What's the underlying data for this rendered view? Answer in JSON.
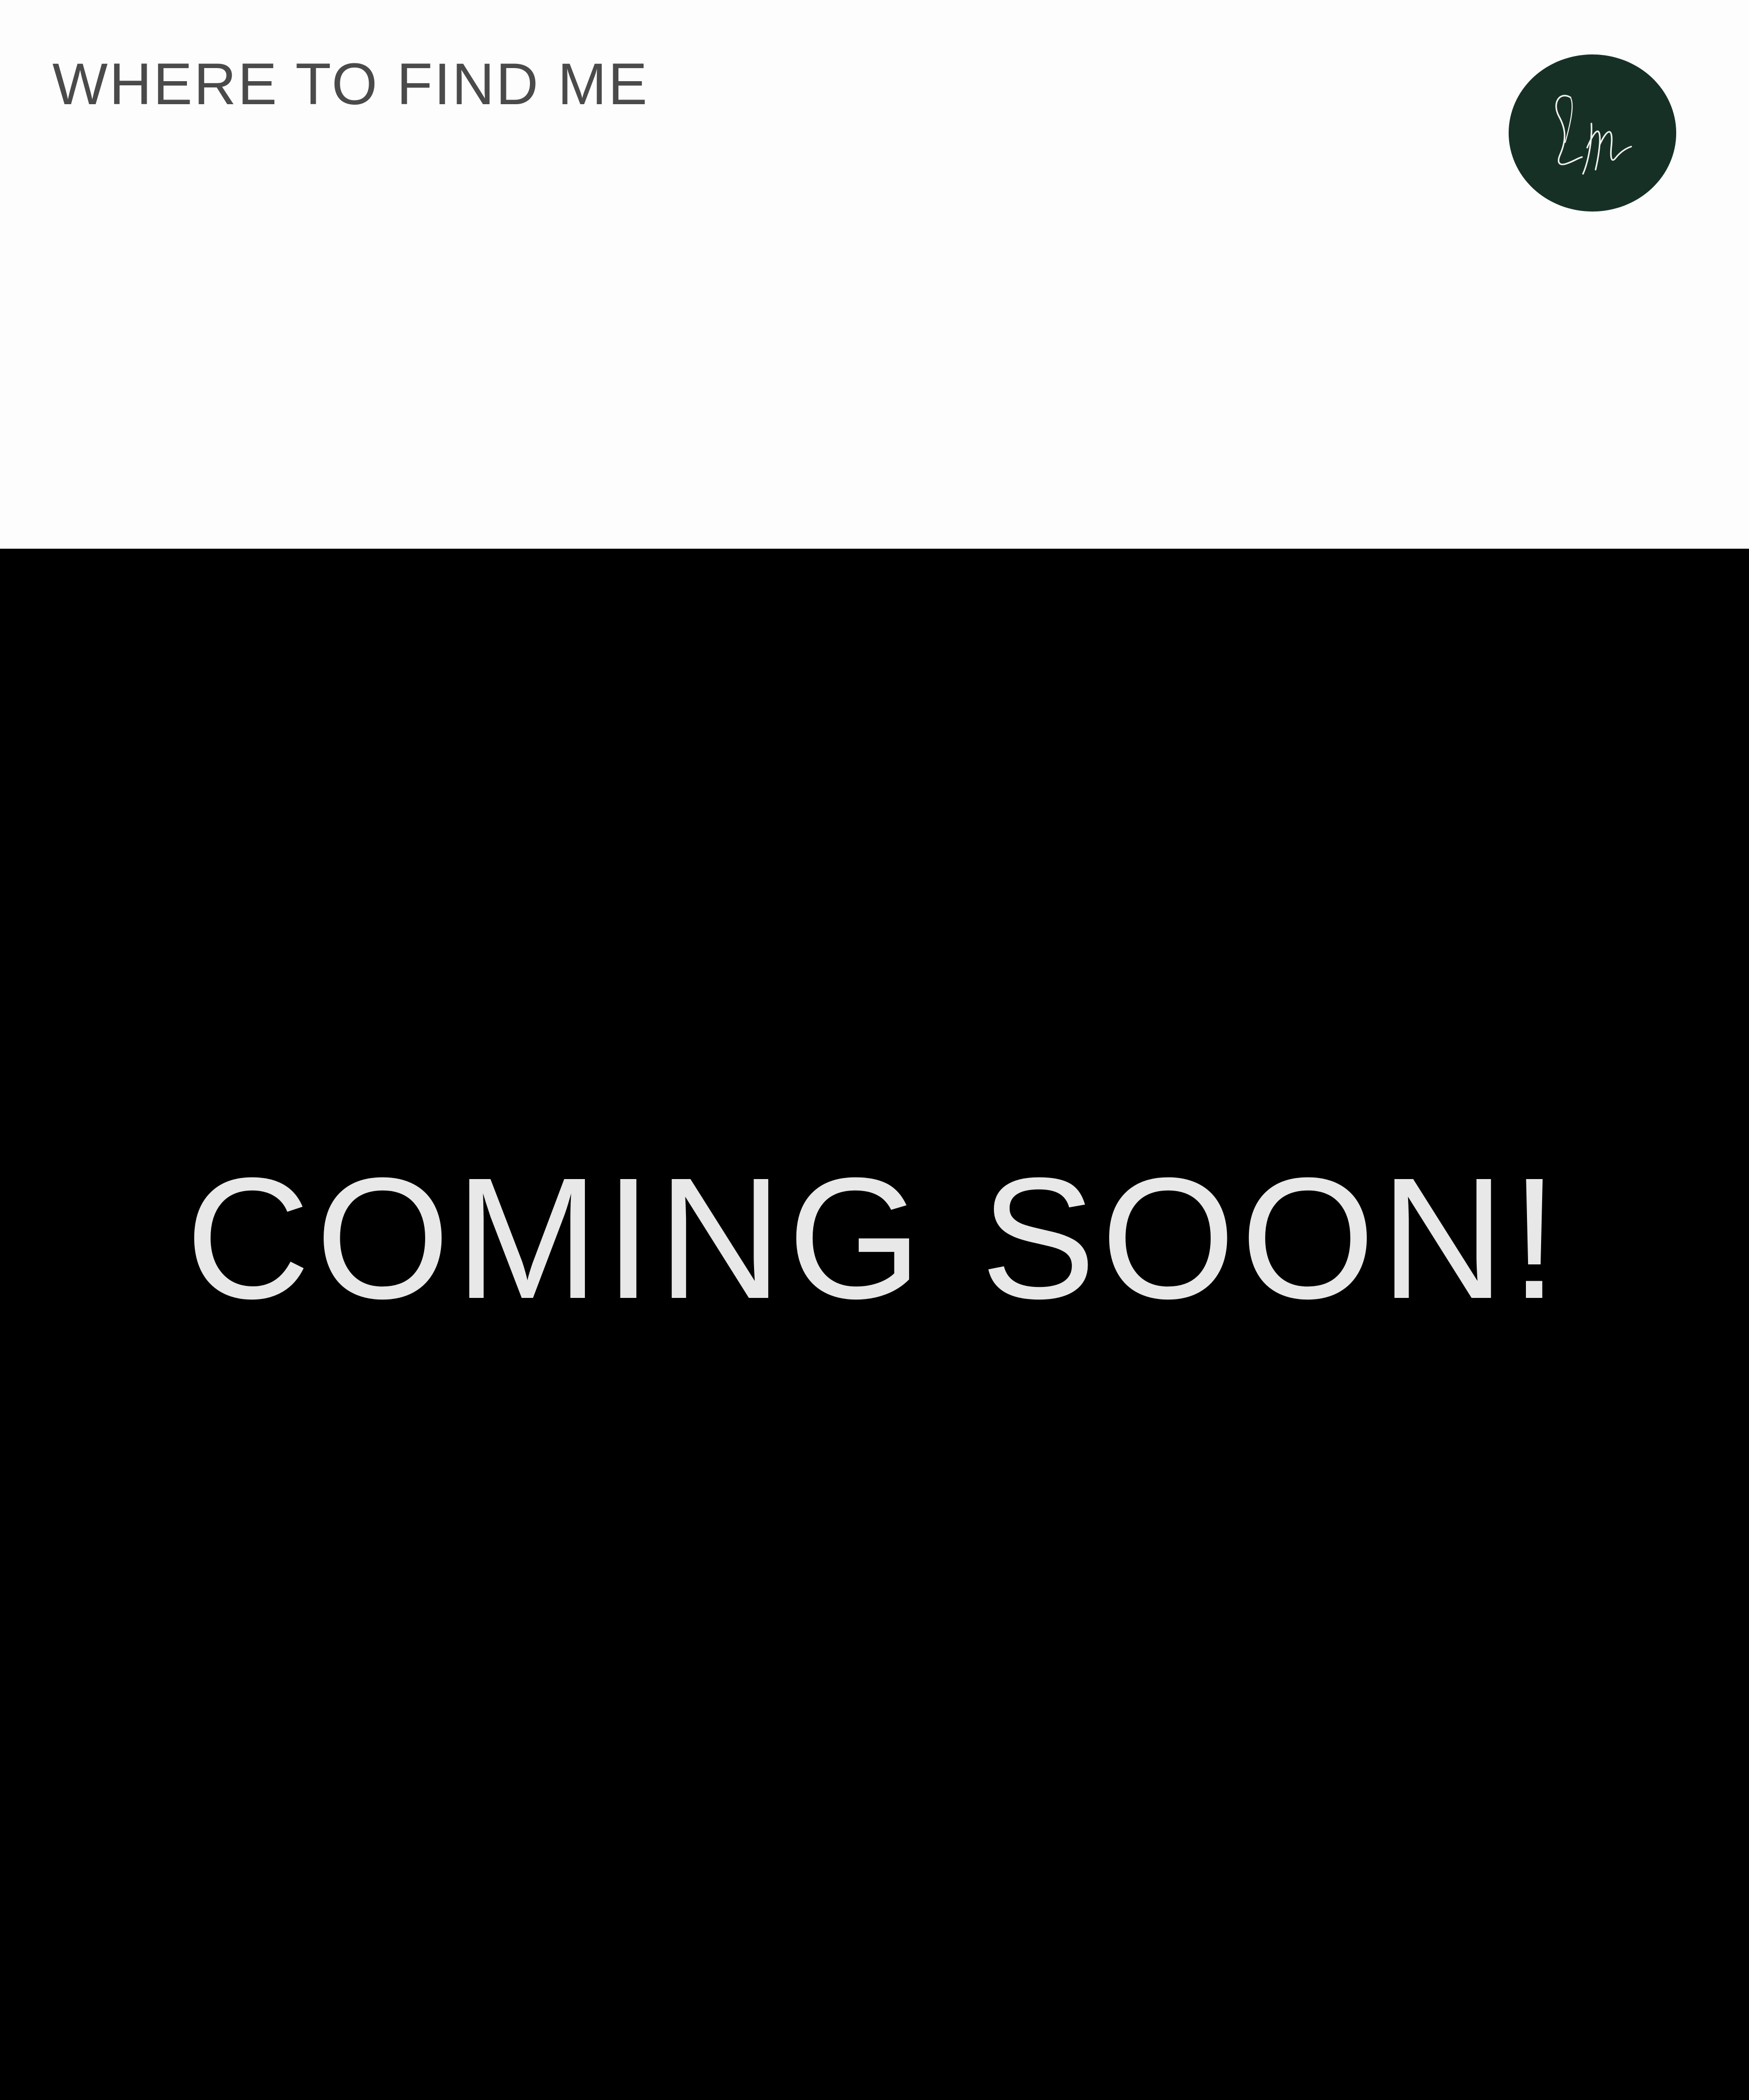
{
  "header": {
    "nav_title": "WHERE TO FIND ME",
    "logo": {
      "icon": "monogram-logo",
      "monogram": "LM",
      "background_color": "#163026"
    }
  },
  "hero": {
    "heading": "COMING SOON!",
    "background_color": "#000000",
    "text_color": "#e8e8e8"
  }
}
